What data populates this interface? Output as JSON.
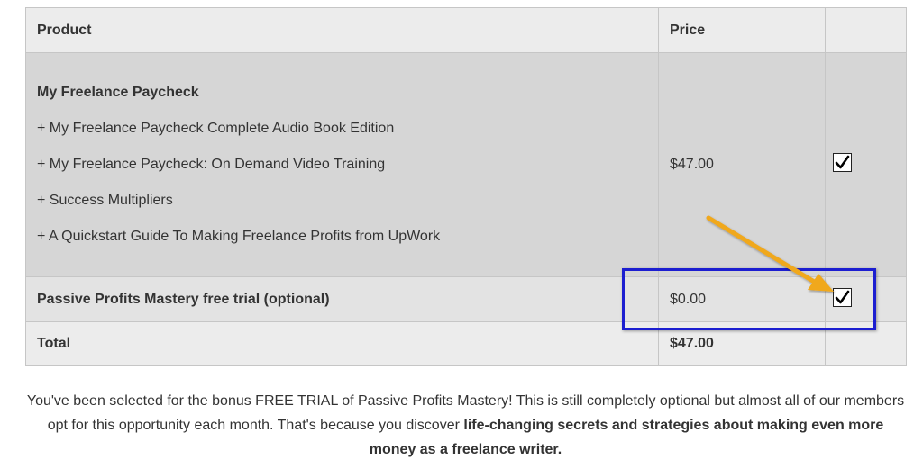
{
  "table": {
    "headers": {
      "product": "Product",
      "price": "Price"
    },
    "main_product": {
      "title": "My Freelance Paycheck",
      "bumps": [
        "+ My Freelance Paycheck Complete Audio Book Edition",
        "+ My Freelance Paycheck: On Demand Video Training",
        "+ Success Multipliers",
        "+ A Quickstart Guide To Making Freelance Profits from UpWork"
      ],
      "price": "$47.00",
      "checked": true
    },
    "trial": {
      "title": "Passive Profits Mastery free trial (optional)",
      "price": "$0.00",
      "checked": true
    },
    "total": {
      "label": "Total",
      "price": "$47.00"
    }
  },
  "footer": {
    "text_plain": "You've been selected for the bonus FREE TRIAL of Passive Profits Mastery! This is still completely optional but almost all of our members opt for this opportunity each month. That's because you discover ",
    "text_bold": "life-changing secrets and strategies about making even more money as a freelance writer."
  },
  "colors": {
    "highlight_box": "#1c1ed0",
    "arrow": "#f0a81e"
  },
  "icons": {
    "checkbox": "checkmark-icon",
    "arrow": "arrow-icon"
  }
}
